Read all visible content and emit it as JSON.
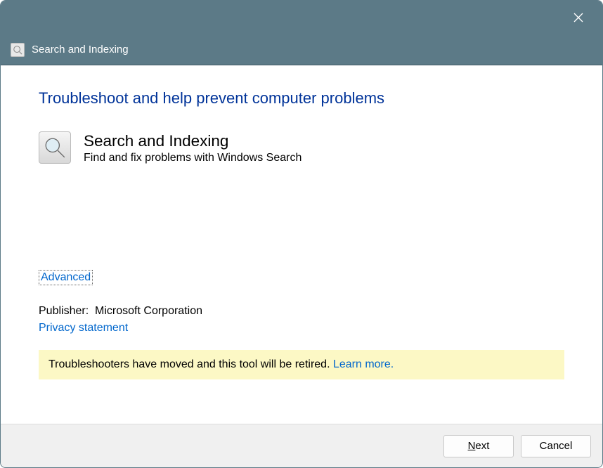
{
  "titlebar": {
    "title": "Search and Indexing"
  },
  "content": {
    "heading": "Troubleshoot and help prevent computer problems",
    "troubleshooter": {
      "title": "Search and Indexing",
      "description": "Find and fix problems with Windows Search"
    },
    "advanced_link": "Advanced",
    "publisher_label": "Publisher:",
    "publisher_value": "Microsoft Corporation",
    "privacy_link": "Privacy statement",
    "notice_text": "Troubleshooters have moved and this tool will be retired. ",
    "notice_link": "Learn more."
  },
  "footer": {
    "next": "Next",
    "cancel": "Cancel"
  }
}
